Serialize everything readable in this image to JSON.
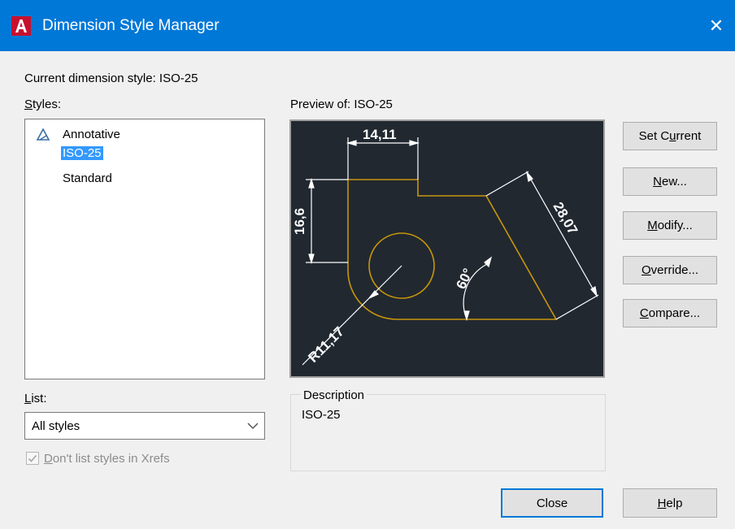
{
  "window": {
    "title": "Dimension Style Manager",
    "close_glyph": "✕"
  },
  "current_style": {
    "label": "Current dimension style: ISO-25"
  },
  "styles": {
    "label_u": "S",
    "label_rest": "tyles:",
    "items": [
      {
        "label": "Annotative",
        "icon": "annotative-icon"
      },
      {
        "label": "ISO-25",
        "selected": true
      },
      {
        "label": "Standard"
      }
    ]
  },
  "preview": {
    "label": "Preview of: ISO-25",
    "dims": {
      "width": "14,11",
      "height": "16,6",
      "slant": "28,07",
      "angle": "60°",
      "radius": "R11,17"
    }
  },
  "buttons": {
    "set_current_a": "Set C",
    "set_current_u": "u",
    "set_current_b": "rrent",
    "new_u": "N",
    "new_rest": "ew...",
    "modify_u": "M",
    "modify_rest": "odify...",
    "override_u": "O",
    "override_rest": "verride...",
    "compare_u": "C",
    "compare_rest": "ompare...",
    "close": "Close",
    "help_u": "H",
    "help_rest": "elp"
  },
  "list": {
    "label_u": "L",
    "label_rest": "ist:",
    "selected": "All styles"
  },
  "xrefs": {
    "label_u": "D",
    "label_rest": "on't list styles in Xrefs",
    "checked": true
  },
  "description": {
    "legend": "Description",
    "text": "ISO-25"
  },
  "colors": {
    "title_bar": "#0078d7",
    "preview_bg": "#212830",
    "geometry": "#c8960a",
    "selection": "#3399ff"
  }
}
